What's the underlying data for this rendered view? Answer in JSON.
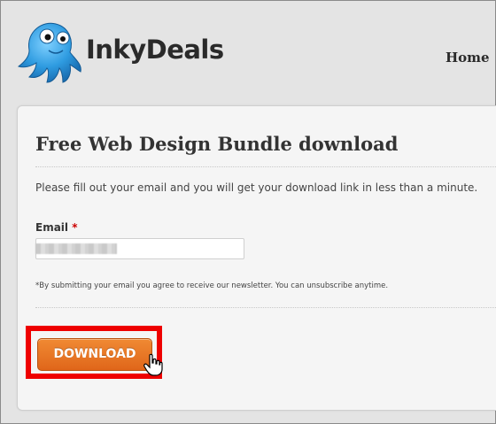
{
  "header": {
    "brand": "InkyDeals",
    "nav": {
      "home": "Home"
    }
  },
  "form": {
    "title": "Free Web Design Bundle download",
    "intro": "Please fill out your email and you will get your download link in less than a minute.",
    "email_label": "Email",
    "required_mark": "*",
    "email_value": "",
    "note": "*By submitting your email you agree to receive our newsletter. You can unsubscribe anytime.",
    "download_label": "DOWNLOAD"
  },
  "colors": {
    "button": "#e8731f",
    "highlight": "#ee0000",
    "required": "#cc0000"
  },
  "icons": [
    "octopus-mascot-logo",
    "hand-pointer-cursor"
  ]
}
